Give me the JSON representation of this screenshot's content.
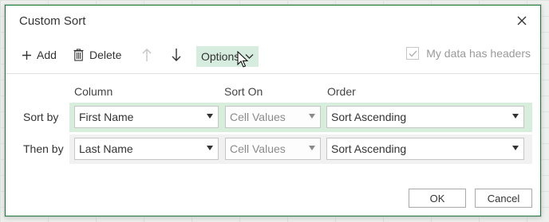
{
  "dialog": {
    "title": "Custom Sort",
    "close_icon": "close-icon"
  },
  "toolbar": {
    "add_label": "Add",
    "delete_label": "Delete",
    "move_up_icon": "arrow-up-icon",
    "move_down_icon": "arrow-down-icon",
    "options_label": "Options",
    "headers_label": "My data has headers",
    "headers_checked": true
  },
  "columns": {
    "column": "Column",
    "sort_on": "Sort On",
    "order": "Order"
  },
  "rows": [
    {
      "label": "Sort by",
      "column": "First Name",
      "sort_on": "Cell Values",
      "order": "Sort Ascending",
      "selected": true
    },
    {
      "label": "Then by",
      "column": "Last Name",
      "sort_on": "Cell Values",
      "order": "Sort Ascending",
      "selected": false
    }
  ],
  "footer": {
    "ok_label": "OK",
    "cancel_label": "Cancel"
  },
  "colors": {
    "accent": "#1f7a3d",
    "selected_row": "#d7eedd",
    "options_bg": "#d6ecde"
  }
}
